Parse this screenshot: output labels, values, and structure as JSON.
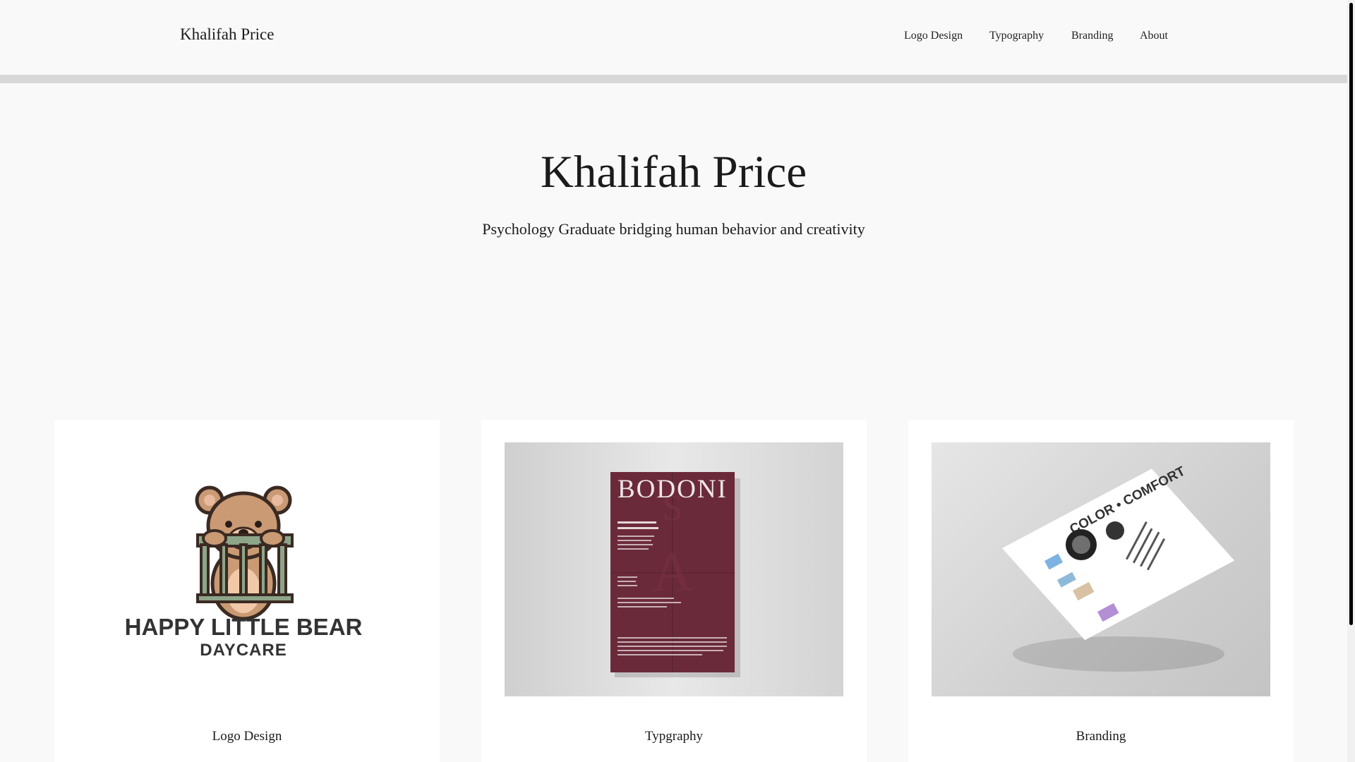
{
  "header": {
    "brand": "Khalifah Price",
    "nav": [
      "Logo Design",
      "Typography",
      "Branding",
      "About"
    ]
  },
  "hero": {
    "title": "Khalifah Price",
    "subtitle": "Psychology Graduate bridging human behavior and creativity"
  },
  "cards": [
    {
      "label": "Logo Design",
      "image_text": {
        "line1": "HAPPY LITTLE BEAR",
        "line2": "DAYCARE"
      }
    },
    {
      "label": "Typgraphy",
      "image_text": {
        "title": "BODONI"
      }
    },
    {
      "label": "Branding",
      "image_text": {
        "title": "COLOR • COMFORT"
      }
    }
  ],
  "colors": {
    "background": "#f9f9f9",
    "card": "#ffffff",
    "divider": "#d8d8d8",
    "text": "#1b1b1b",
    "poster": "#6b2a3a"
  }
}
